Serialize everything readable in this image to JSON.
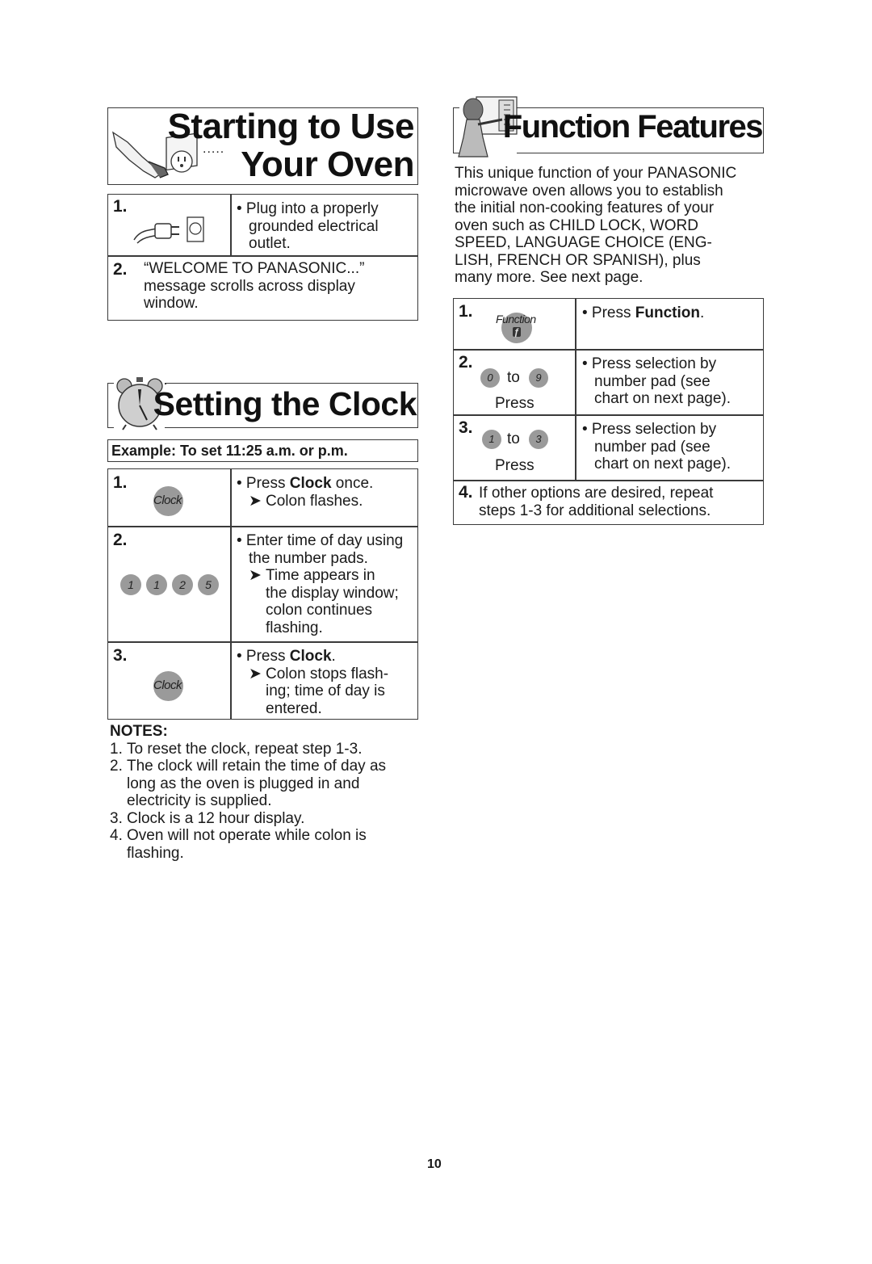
{
  "starting": {
    "title_line1": "Starting to Use",
    "title_line2": "Your Oven",
    "dots": ".....",
    "icon": "plug-into-outlet-icon",
    "steps": [
      {
        "number": "1.",
        "icon": "plug-and-outlet-icon",
        "text_lines": [
          "• Plug into a properly",
          "grounded electrical",
          "outlet."
        ]
      },
      {
        "number": "2.",
        "text_lines": [
          "“WELCOME TO PANASONIC...”",
          "message scrolls across display",
          "window."
        ]
      }
    ]
  },
  "clock": {
    "title": "Setting the Clock",
    "icon": "alarm-clock-icon",
    "example": "Example: To set 11:25 a.m. or p.m.",
    "steps": [
      {
        "number": "1.",
        "pad_label": "Clock",
        "bullet": "• Press ",
        "bold": "Clock",
        "after": " once.",
        "arrow": "➤",
        "sub_lines": [
          "Colon flashes."
        ]
      },
      {
        "number": "2.",
        "pads": [
          "1",
          "1",
          "2",
          "5"
        ],
        "text_lines": [
          "• Enter time of day using",
          "the number pads."
        ],
        "arrow": "➤",
        "sub_lines": [
          "Time appears in",
          "the display window;",
          "colon continues",
          "flashing."
        ]
      },
      {
        "number": "3.",
        "pad_label": "Clock",
        "bullet": "• Press ",
        "bold": "Clock",
        "after": ".",
        "arrow": "➤",
        "sub_lines": [
          "Colon stops flash-",
          "ing; time of day is",
          "entered."
        ]
      }
    ],
    "notes": {
      "heading": "NOTES:",
      "items": [
        {
          "n": "1.",
          "lines": [
            "To reset the clock, repeat step 1-3."
          ]
        },
        {
          "n": "2.",
          "lines": [
            "The clock will retain the time of day as",
            "long as the oven is plugged in and",
            "electricity is supplied."
          ]
        },
        {
          "n": "3.",
          "lines": [
            "Clock is a 12 hour display."
          ]
        },
        {
          "n": "4.",
          "lines": [
            "Oven will not operate while colon is",
            "flashing."
          ]
        }
      ]
    }
  },
  "function": {
    "title": "Function Features",
    "icon": "woman-pressing-oven-panel-icon",
    "intro_lines": [
      "This unique function of your PANASONIC",
      "microwave oven allows you to establish",
      "the initial non-cooking features of your",
      "oven such as CHILD LOCK, WORD",
      "SPEED, LANGUAGE CHOICE (ENG-",
      "LISH, FRENCH OR SPANISH), plus",
      "many more. See next page."
    ],
    "steps": [
      {
        "number": "1.",
        "pad_label": "Function",
        "pad_glyph": "ƒ",
        "bullet": "• Press ",
        "bold": "Function",
        "after": "."
      },
      {
        "number": "2.",
        "pad_from": "0",
        "to_word": "to",
        "pad_to": "9",
        "press": "Press",
        "text_lines": [
          "• Press selection by",
          "number pad (see",
          "chart on next page)."
        ]
      },
      {
        "number": "3.",
        "pad_from": "1",
        "to_word": "to",
        "pad_to": "3",
        "press": "Press",
        "text_lines": [
          "• Press selection by",
          "number pad (see",
          "chart on next page)."
        ]
      },
      {
        "number": "4.",
        "text_lines": [
          "If other options are desired, repeat",
          "steps 1-3 for additional selections."
        ]
      }
    ]
  },
  "page_number": "10"
}
